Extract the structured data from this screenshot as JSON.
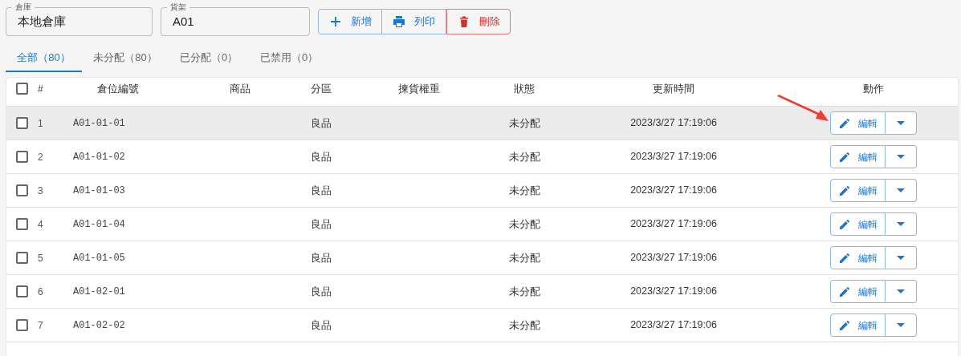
{
  "filters": [
    {
      "label": "倉庫",
      "value": "本地倉庫"
    },
    {
      "label": "貨架",
      "value": "A01"
    }
  ],
  "actions": [
    {
      "kind": "add",
      "label": "新增"
    },
    {
      "kind": "print",
      "label": "列印"
    },
    {
      "kind": "delete",
      "label": "刪除"
    }
  ],
  "tabs": [
    {
      "label": "全部（80）",
      "selected": true
    },
    {
      "label": "未分配（80）",
      "selected": false
    },
    {
      "label": "已分配（0）",
      "selected": false
    },
    {
      "label": "已禁用（0）",
      "selected": false
    }
  ],
  "table": {
    "select_all_checked": false,
    "columns": [
      "#",
      "倉位編號",
      "商品",
      "分區",
      "揀貨權重",
      "狀態",
      "更新時間",
      "動作"
    ],
    "rows": [
      {
        "checked": false,
        "highlighted": true,
        "number": "1",
        "code": "A01-01-01",
        "zone": "良品",
        "status": "未分配",
        "updated": "2023/3/27 17:19:06",
        "action": "編輯"
      },
      {
        "checked": false,
        "highlighted": false,
        "number": "2",
        "code": "A01-01-02",
        "zone": "良品",
        "status": "未分配",
        "updated": "2023/3/27 17:19:06",
        "action": "編輯"
      },
      {
        "checked": false,
        "highlighted": false,
        "number": "3",
        "code": "A01-01-03",
        "zone": "良品",
        "status": "未分配",
        "updated": "2023/3/27 17:19:06",
        "action": "編輯"
      },
      {
        "checked": false,
        "highlighted": false,
        "number": "4",
        "code": "A01-01-04",
        "zone": "良品",
        "status": "未分配",
        "updated": "2023/3/27 17:19:06",
        "action": "編輯"
      },
      {
        "checked": false,
        "highlighted": false,
        "number": "5",
        "code": "A01-01-05",
        "zone": "良品",
        "status": "未分配",
        "updated": "2023/3/27 17:19:06",
        "action": "編輯"
      },
      {
        "checked": false,
        "highlighted": false,
        "number": "6",
        "code": "A01-02-01",
        "zone": "良品",
        "status": "未分配",
        "updated": "2023/3/27 17:19:06",
        "action": "編輯"
      },
      {
        "checked": false,
        "highlighted": false,
        "number": "7",
        "code": "A01-02-02",
        "zone": "良品",
        "status": "未分配",
        "updated": "2023/3/27 17:19:06",
        "action": "編輯"
      }
    ]
  }
}
